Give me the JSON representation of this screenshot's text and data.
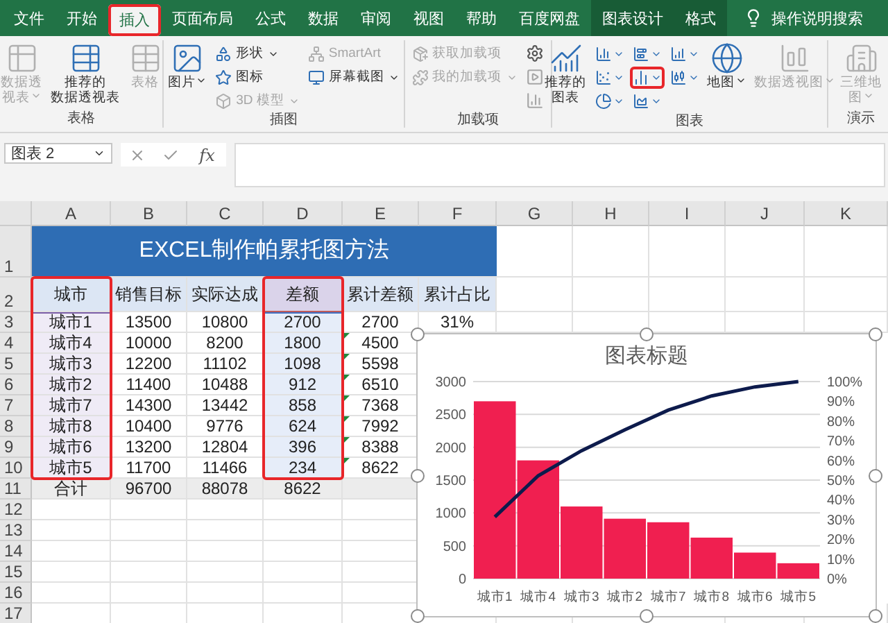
{
  "ribbon_tabs": [
    {
      "label": "文件",
      "selected": false,
      "contextual": false,
      "marked": false
    },
    {
      "label": "开始",
      "selected": false,
      "contextual": false,
      "marked": false
    },
    {
      "label": "插入",
      "selected": true,
      "contextual": false,
      "marked": true
    },
    {
      "label": "页面布局",
      "selected": false,
      "contextual": false,
      "marked": false
    },
    {
      "label": "公式",
      "selected": false,
      "contextual": false,
      "marked": false
    },
    {
      "label": "数据",
      "selected": false,
      "contextual": false,
      "marked": false
    },
    {
      "label": "审阅",
      "selected": false,
      "contextual": false,
      "marked": false
    },
    {
      "label": "视图",
      "selected": false,
      "contextual": false,
      "marked": false
    },
    {
      "label": "帮助",
      "selected": false,
      "contextual": false,
      "marked": false
    },
    {
      "label": "百度网盘",
      "selected": false,
      "contextual": false,
      "marked": false
    },
    {
      "label": "图表设计",
      "selected": false,
      "contextual": true,
      "marked": false
    },
    {
      "label": "格式",
      "selected": false,
      "contextual": true,
      "marked": false
    }
  ],
  "tell_me": {
    "text": "操作说明搜索"
  },
  "ribbon_groups": [
    {
      "label": "表格",
      "columns": [
        {
          "kind": "large",
          "lines": [
            "数据透",
            "视表"
          ],
          "dropdown": true,
          "disabled": true
        },
        {
          "kind": "large",
          "lines": [
            "推荐的",
            "数据透视表"
          ],
          "dropdown": false,
          "disabled": false
        },
        {
          "kind": "large",
          "lines": [
            "表格"
          ],
          "dropdown": false,
          "disabled": true
        }
      ]
    },
    {
      "label": "插图",
      "columns": [
        {
          "kind": "large",
          "lines": [
            "图片"
          ],
          "dropdown": true,
          "disabled": false
        },
        {
          "kind": "stack",
          "items": [
            {
              "label": "形状",
              "dropdown": true,
              "disabled": false
            },
            {
              "label": "图标",
              "dropdown": false,
              "disabled": false
            },
            {
              "label": "3D 模型",
              "dropdown": true,
              "disabled": true
            }
          ]
        },
        {
          "kind": "stack",
          "items": [
            {
              "label": "SmartArt",
              "dropdown": false,
              "disabled": true
            },
            {
              "label": "屏幕截图",
              "dropdown": true,
              "disabled": false
            }
          ]
        }
      ]
    },
    {
      "label": "加载项",
      "columns": [
        {
          "kind": "stack",
          "items": [
            {
              "label": "获取加载项",
              "dropdown": false,
              "disabled": true
            },
            {
              "label": "我的加载项",
              "dropdown": true,
              "disabled": true
            }
          ]
        },
        {
          "kind": "icons",
          "items": [
            {
              "disabled": false
            },
            {
              "disabled": true
            },
            {
              "disabled": true
            }
          ]
        }
      ]
    },
    {
      "label": "图表",
      "columns": [
        {
          "kind": "large",
          "lines": [
            "推荐的",
            "图表"
          ],
          "dropdown": false,
          "disabled": false
        },
        {
          "kind": "chart-grid",
          "items": [
            {
              "marked": false
            },
            {
              "marked": false
            },
            {
              "marked": false
            },
            {
              "marked": false
            },
            {
              "marked": true
            },
            {
              "marked": false
            },
            {
              "marked": false
            },
            {
              "marked": false
            }
          ]
        },
        {
          "kind": "large",
          "lines": [
            "地图"
          ],
          "dropdown": true,
          "disabled": false
        },
        {
          "kind": "large",
          "lines": [
            "数据透视图"
          ],
          "dropdown": true,
          "disabled": true
        }
      ]
    },
    {
      "label": "演示",
      "columns": [
        {
          "kind": "large",
          "lines": [
            "三维地",
            "图"
          ],
          "dropdown": true,
          "disabled": true
        }
      ]
    }
  ],
  "formula_bar": {
    "name_box": "图表 2",
    "function_label": "fx"
  },
  "columns": [
    "A",
    "B",
    "C",
    "D",
    "E",
    "F",
    "G",
    "H",
    "I",
    "J",
    "K"
  ],
  "rows": [
    {
      "number": "1",
      "cells": [
        {
          "text": "EXCEL制作帕累托图方法",
          "kind": "title"
        }
      ]
    },
    {
      "number": "2",
      "cells": [
        {
          "text": "城市",
          "kind": "header"
        },
        {
          "text": "销售目标",
          "kind": "header"
        },
        {
          "text": "实际达成",
          "kind": "header"
        },
        {
          "text": "差额",
          "kind": "series-name"
        },
        {
          "text": "累计差额",
          "kind": "header"
        },
        {
          "text": "累计占比",
          "kind": "header"
        }
      ]
    },
    {
      "number": "3",
      "cells": [
        {
          "text": "城市1",
          "kind": "category"
        },
        {
          "text": "13500",
          "kind": "plain"
        },
        {
          "text": "10800",
          "kind": "plain"
        },
        {
          "text": "2700",
          "kind": "values"
        },
        {
          "text": "2700",
          "kind": "plain",
          "flag": false
        },
        {
          "text": "31%",
          "kind": "plain"
        }
      ]
    },
    {
      "number": "4",
      "cells": [
        {
          "text": "城市4",
          "kind": "category"
        },
        {
          "text": "10000",
          "kind": "plain"
        },
        {
          "text": "8200",
          "kind": "plain"
        },
        {
          "text": "1800",
          "kind": "values"
        },
        {
          "text": "4500",
          "kind": "plain",
          "flag": true
        }
      ]
    },
    {
      "number": "5",
      "cells": [
        {
          "text": "城市3",
          "kind": "category"
        },
        {
          "text": "12200",
          "kind": "plain"
        },
        {
          "text": "11102",
          "kind": "plain"
        },
        {
          "text": "1098",
          "kind": "values"
        },
        {
          "text": "5598",
          "kind": "plain",
          "flag": true
        }
      ]
    },
    {
      "number": "6",
      "cells": [
        {
          "text": "城市2",
          "kind": "category"
        },
        {
          "text": "11400",
          "kind": "plain"
        },
        {
          "text": "10488",
          "kind": "plain"
        },
        {
          "text": "912",
          "kind": "values"
        },
        {
          "text": "6510",
          "kind": "plain",
          "flag": true
        }
      ]
    },
    {
      "number": "7",
      "cells": [
        {
          "text": "城市7",
          "kind": "category"
        },
        {
          "text": "14300",
          "kind": "plain"
        },
        {
          "text": "13442",
          "kind": "plain"
        },
        {
          "text": "858",
          "kind": "values"
        },
        {
          "text": "7368",
          "kind": "plain",
          "flag": true
        }
      ]
    },
    {
      "number": "8",
      "cells": [
        {
          "text": "城市8",
          "kind": "category"
        },
        {
          "text": "10400",
          "kind": "plain"
        },
        {
          "text": "9776",
          "kind": "plain"
        },
        {
          "text": "624",
          "kind": "values"
        },
        {
          "text": "7992",
          "kind": "plain",
          "flag": true
        }
      ]
    },
    {
      "number": "9",
      "cells": [
        {
          "text": "城市6",
          "kind": "category"
        },
        {
          "text": "13200",
          "kind": "plain"
        },
        {
          "text": "12804",
          "kind": "plain"
        },
        {
          "text": "396",
          "kind": "values"
        },
        {
          "text": "8388",
          "kind": "plain",
          "flag": true
        }
      ]
    },
    {
      "number": "10",
      "cells": [
        {
          "text": "城市5",
          "kind": "category"
        },
        {
          "text": "11700",
          "kind": "plain"
        },
        {
          "text": "11466",
          "kind": "plain"
        },
        {
          "text": "234",
          "kind": "values"
        },
        {
          "text": "8622",
          "kind": "plain",
          "flag": true
        }
      ]
    },
    {
      "number": "11",
      "cells": [
        {
          "text": "合计",
          "kind": "total"
        },
        {
          "text": "96700",
          "kind": "total"
        },
        {
          "text": "88078",
          "kind": "total"
        },
        {
          "text": "8622",
          "kind": "total"
        },
        {
          "kind": "total",
          "flag": false
        }
      ]
    },
    {
      "number": "12"
    },
    {
      "number": "13"
    },
    {
      "number": "14"
    },
    {
      "number": "15"
    },
    {
      "number": "16"
    },
    {
      "number": "17"
    }
  ],
  "chart": {
    "title": "图表标题",
    "chart_data": {
      "type": "bar",
      "categories": [
        "城市1",
        "城市4",
        "城市3",
        "城市2",
        "城市7",
        "城市8",
        "城市6",
        "城市5"
      ],
      "series": [
        {
          "color": "#f01f50",
          "values": [
            2700,
            1800,
            1098,
            912,
            858,
            624,
            396,
            234
          ]
        },
        {
          "type": "line",
          "axis": "y2",
          "color": "#0d1b4c",
          "values": [
            31.3,
            52.2,
            64.9,
            75.5,
            85.5,
            92.7,
            97.3,
            100
          ]
        }
      ],
      "grid": true,
      "ylim": [
        0,
        3000
      ],
      "yticks": [
        0,
        500,
        1000,
        1500,
        2000,
        2500,
        3000
      ],
      "y2lim": [
        0,
        100
      ],
      "y2ticks": [
        {
          "value": 0,
          "label": "0%"
        },
        {
          "value": 10,
          "label": "10%"
        },
        {
          "value": 20,
          "label": "20%"
        },
        {
          "value": 30,
          "label": "30%"
        },
        {
          "value": 40,
          "label": "40%"
        },
        {
          "value": 50,
          "label": "50%"
        },
        {
          "value": 60,
          "label": "60%"
        },
        {
          "value": 70,
          "label": "70%"
        },
        {
          "value": 80,
          "label": "80%"
        },
        {
          "value": 90,
          "label": "90%"
        },
        {
          "value": 100,
          "label": "100%"
        }
      ]
    }
  }
}
